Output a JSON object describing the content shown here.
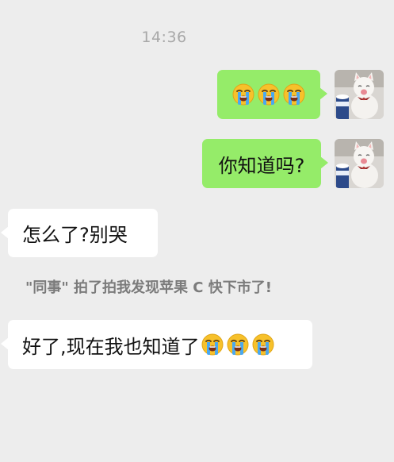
{
  "chat": {
    "timestamp": "14:36",
    "messages": [
      {
        "from": "me",
        "emoji": [
          "loudly-crying-face-icon",
          "loudly-crying-face-icon",
          "loudly-crying-face-icon"
        ]
      },
      {
        "from": "me",
        "text": "你知道吗?"
      },
      {
        "from": "other",
        "text": "怎么了?别哭"
      },
      {
        "type": "system",
        "text": "\"同事\" 拍了拍我发现苹果 C 快下市了!"
      },
      {
        "from": "other",
        "text": "好了,现在我也知道了",
        "emoji": [
          "loudly-crying-face-icon",
          "loudly-crying-face-icon",
          "loudly-crying-face-icon"
        ]
      }
    ]
  },
  "colors": {
    "background": "#ededed",
    "sent_bubble": "#95ec69",
    "received_bubble": "#ffffff",
    "timestamp_text": "#a8a8a8",
    "system_text": "#7b7b7b"
  },
  "avatar": {
    "icon": "white-cat-avatar-icon"
  }
}
